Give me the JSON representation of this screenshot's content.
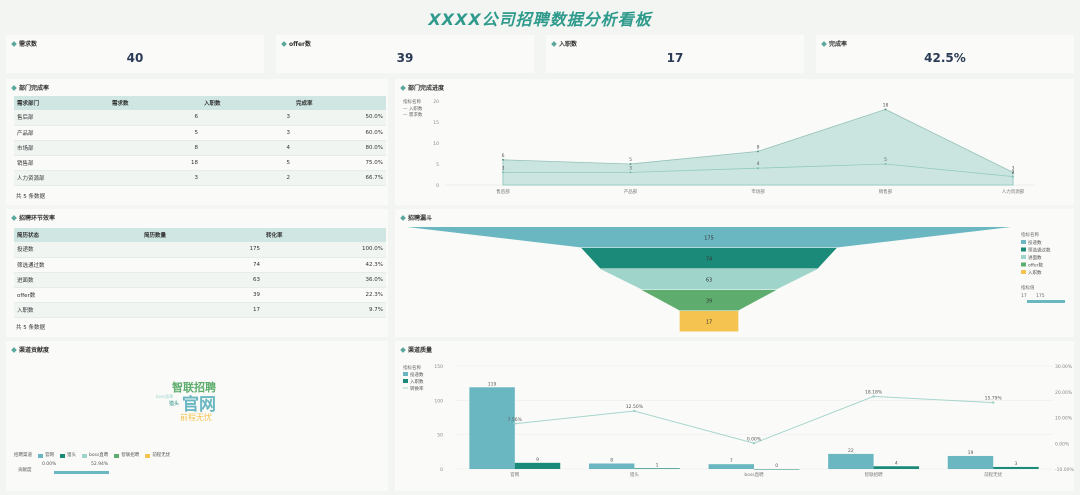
{
  "page_title": "XXXX公司招聘数据分析看板",
  "kpis": [
    {
      "label": "需求数",
      "value": "40"
    },
    {
      "label": "offer数",
      "value": "39"
    },
    {
      "label": "入职数",
      "value": "17"
    },
    {
      "label": "完成率",
      "value": "42.5%"
    }
  ],
  "dept_table": {
    "title": "部门完成率",
    "headers": [
      "需求部门",
      "需求数",
      "入职数",
      "完成率"
    ],
    "rows": [
      [
        "售后部",
        "6",
        "3",
        "50.0%"
      ],
      [
        "产品部",
        "5",
        "3",
        "60.0%"
      ],
      [
        "市场部",
        "8",
        "4",
        "80.0%"
      ],
      [
        "销售部",
        "18",
        "5",
        "75.0%"
      ],
      [
        "人力资源部",
        "3",
        "2",
        "66.7%"
      ]
    ],
    "footer": "共 5 条数据"
  },
  "funnel_table": {
    "title": "招聘环节效率",
    "headers": [
      "简历状态",
      "简历数量",
      "转化率"
    ],
    "rows": [
      [
        "投递数",
        "175",
        "100.0%"
      ],
      [
        "筛选通过数",
        "74",
        "42.3%"
      ],
      [
        "进面数",
        "63",
        "36.0%"
      ],
      [
        "offer数",
        "39",
        "22.3%"
      ],
      [
        "入职数",
        "17",
        "9.7%"
      ]
    ],
    "footer": "共 5 条数据"
  },
  "channel_contrib": {
    "title": "渠道贡献度",
    "logo": {
      "top": "智联招聘",
      "mid": "官网",
      "left": "boss直聘",
      "left2": "猎头",
      "bottom": "前程无忧"
    },
    "legend_title": "招聘渠道",
    "legend": [
      "官网",
      "猎头",
      "boss直聘",
      "智联招聘",
      "前程无忧"
    ],
    "bar_label": "贡献度",
    "range_min": "0.00%",
    "range_max": "52.94%"
  },
  "colors": {
    "teal": "#6ab7c2",
    "dark_teal": "#1b8a78",
    "light_teal": "#9fd4cb",
    "green": "#5fad6e",
    "yellow": "#f5c34f",
    "area": "#b7dcd6",
    "line_light": "#a6d5cc"
  },
  "chart_data": [
    {
      "type": "area",
      "title": "部门完成进度",
      "legend_title": "指标名称",
      "categories": [
        "售后部",
        "产品部",
        "市场部",
        "销售部",
        "人力资源部"
      ],
      "series": [
        {
          "name": "入职数",
          "values": [
            3,
            3,
            4,
            5,
            2
          ]
        },
        {
          "name": "需求数",
          "values": [
            6,
            5,
            8,
            18,
            3
          ]
        }
      ],
      "ylim": [
        0,
        20
      ],
      "yticks": [
        "0",
        "5",
        "10",
        "15",
        "20"
      ],
      "legend": "top-left"
    },
    {
      "type": "bar",
      "subtype": "funnel",
      "title": "招聘漏斗",
      "legend_title": "指标名称",
      "categories": [
        "投递数",
        "筛选通过数",
        "进面数",
        "offer数",
        "入职数"
      ],
      "values": [
        175,
        74,
        63,
        39,
        17
      ],
      "slider_title": "指标值",
      "slider_min": "17",
      "slider_max": "175",
      "legend": "right"
    },
    {
      "type": "bar",
      "title": "渠道质量",
      "legend_title": "指标名称",
      "categories": [
        "官网",
        "猎头",
        "boss直聘",
        "智联招聘",
        "前程无忧"
      ],
      "series": [
        {
          "name": "投递数",
          "values": [
            119,
            8,
            7,
            22,
            19
          ]
        },
        {
          "name": "入职数",
          "values": [
            9,
            1,
            0,
            4,
            3
          ]
        },
        {
          "name": "转换率",
          "values": [
            7.56,
            12.5,
            0.0,
            18.18,
            15.79
          ],
          "labels": [
            "7.56%",
            "12.50%",
            "0.00%",
            "18.18%",
            "15.79%"
          ]
        }
      ],
      "ylim": [
        0,
        150
      ],
      "yticks": [
        "0",
        "50",
        "100",
        "150"
      ],
      "y2ticks": [
        "-10.00%",
        "0.00%",
        "10.00%",
        "20.00%",
        "30.00%"
      ],
      "legend": "top-left"
    }
  ]
}
